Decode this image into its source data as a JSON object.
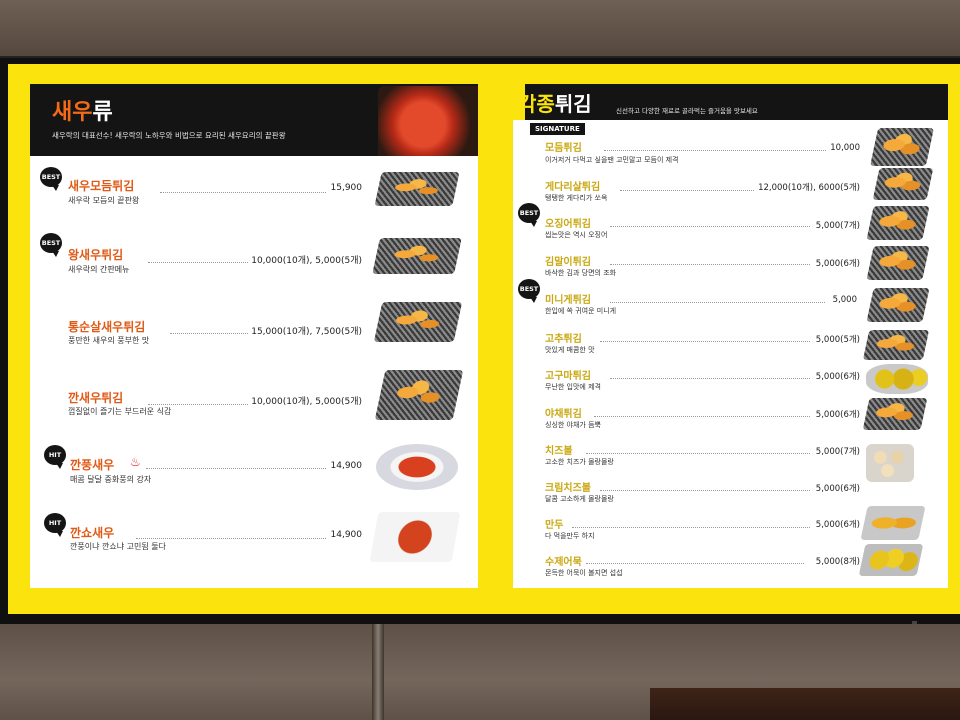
{
  "left": {
    "title_accent": "새우",
    "title_rest": "류",
    "subtitle": "새우락의 대표선수! 새우락의 노하우와 비법으로 요리된  새우요리의 끝판왕",
    "items": [
      {
        "badge": "BEST",
        "name": "새우모듬튀김",
        "desc": "새우락 모듬의 끝판왕",
        "price": "15,900"
      },
      {
        "badge": "BEST",
        "name": "왕새우튀김",
        "desc": "새우락의 간판메뉴",
        "price": "10,000(10개), 5,000(5개)"
      },
      {
        "badge": "",
        "name": "통순살새우튀김",
        "desc": "풍만한 새우의 풍부한 맛",
        "price": "15,000(10개), 7,500(5개)"
      },
      {
        "badge": "",
        "name": "깐새우튀김",
        "desc": "껍질없이 즐기는 부드러운 식감",
        "price": "10,000(10개), 5,000(5개)"
      },
      {
        "badge": "HIT",
        "name": "깐풍새우",
        "desc": "매콤 달달 중화풍의 강자",
        "price": "14,900"
      },
      {
        "badge": "HIT",
        "name": "깐쇼새우",
        "desc": "깐풍이냐 깐쇼냐 고민됨 둘다",
        "price": "14,900"
      }
    ]
  },
  "right": {
    "title_accent": "각종",
    "title_rest": "튀김",
    "subtitle": "신선하고 다양한 재료로 골라먹는 즐거움을 맛보세요",
    "signature_label": "SIGNATURE",
    "items": [
      {
        "badge": "",
        "name": "모듬튀김",
        "desc": "이거저거 다먹고 싶을땐 고민말고 모듬이 제격",
        "price": "10,000"
      },
      {
        "badge": "",
        "name": "게다리살튀김",
        "desc": "탱탱한 게다리가 쏘옥",
        "price": "12,000(10개), 6000(5개)"
      },
      {
        "badge": "BEST",
        "name": "오징어튀김",
        "desc": "씹는맛은 역시 오징어",
        "price": "5,000(7개)"
      },
      {
        "badge": "",
        "name": "김말이튀김",
        "desc": "바삭한 김과 당면의 조화",
        "price": "5,000(6개)"
      },
      {
        "badge": "BEST",
        "name": "미니게튀김",
        "desc": "한입에 쏙 귀여운 미니게",
        "price": "5,000"
      },
      {
        "badge": "",
        "name": "고추튀김",
        "desc": "맛있게 매콤한 맛",
        "price": "5,000(5개)"
      },
      {
        "badge": "",
        "name": "고구마튀김",
        "desc": "무난한 입맛에 제격",
        "price": "5,000(6개)"
      },
      {
        "badge": "",
        "name": "야채튀김",
        "desc": "싱싱한 야채가 듬뿍",
        "price": "5,000(6개)"
      },
      {
        "badge": "",
        "name": "치즈볼",
        "desc": "고소한 치즈가 몰랑몰랑",
        "price": "5,000(7개)"
      },
      {
        "badge": "",
        "name": "크림치즈볼",
        "desc": "달콤 고소하게 몰랑몰랑",
        "price": "5,000(6개)"
      },
      {
        "badge": "",
        "name": "만두",
        "desc": "다 먹을만두 하지",
        "price": "5,000(6개)"
      },
      {
        "badge": "",
        "name": "수제어묵",
        "desc": "몬득한 어묵이 볼지면 섭섭",
        "price": "5,000(8개)"
      }
    ]
  },
  "colors": {
    "screen_yellow": "#fbe30e",
    "shrimp_orange": "#f36b19",
    "fry_gold": "#caa812",
    "header_black": "#141414"
  }
}
